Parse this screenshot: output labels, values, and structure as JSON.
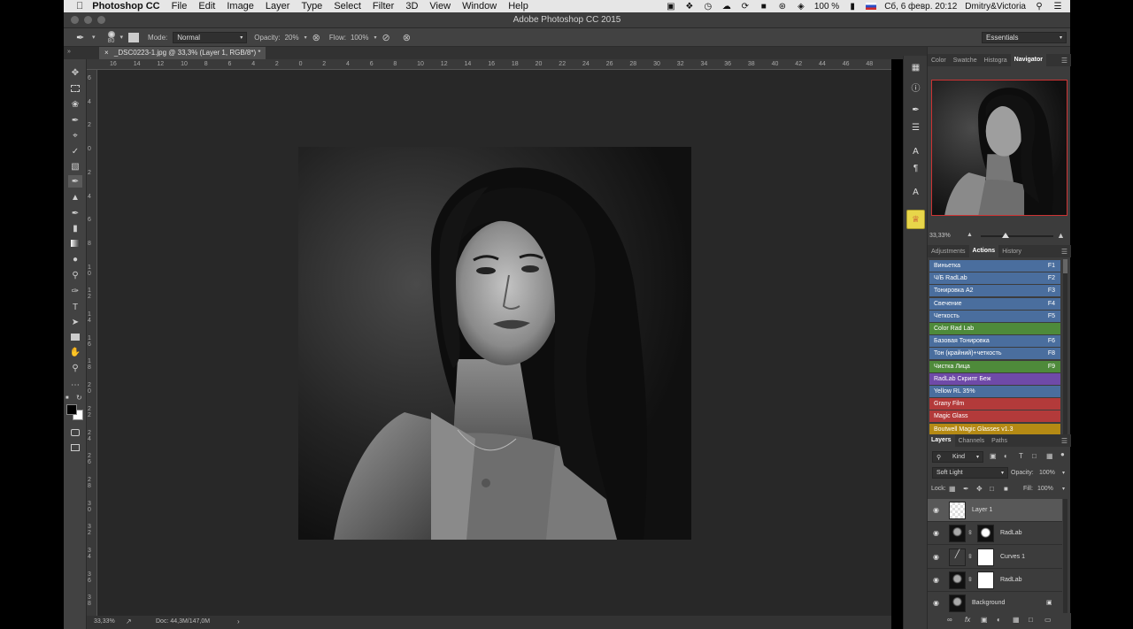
{
  "menubar": {
    "app": "Photoshop CC",
    "items": [
      "File",
      "Edit",
      "Image",
      "Layer",
      "Type",
      "Select",
      "Filter",
      "3D",
      "View",
      "Window",
      "Help"
    ],
    "battery": "100 %",
    "datetime": "Сб, 6 февр.  20:12",
    "user": "Dmitry&Victoria"
  },
  "titlebar": {
    "title": "Adobe Photoshop CC 2015"
  },
  "options": {
    "brush_size": "80",
    "mode_label": "Mode:",
    "mode_value": "Normal",
    "opacity_label": "Opacity:",
    "opacity_value": "20%",
    "flow_label": "Flow:",
    "flow_value": "100%",
    "workspace": "Essentials"
  },
  "document": {
    "tab_title": "_DSC0223-1.jpg @ 33,3% (Layer 1, RGB/8*) *",
    "zoom": "33,33%",
    "doc_size": "Doc: 44,3M/147,0M"
  },
  "ruler": {
    "h_labels": [
      "16",
      "14",
      "12",
      "10",
      "8",
      "6",
      "4",
      "2",
      "0",
      "2",
      "4",
      "6",
      "8",
      "10",
      "12",
      "14",
      "16",
      "18",
      "20",
      "22",
      "24",
      "26",
      "28",
      "30",
      "32",
      "34",
      "36",
      "38",
      "40",
      "42",
      "44",
      "46",
      "48"
    ],
    "v_labels": [
      "6",
      "4",
      "2",
      "0",
      "2",
      "4",
      "6",
      "8",
      "1 0",
      "1 2",
      "1 4",
      "1 6",
      "1 8",
      "2 0",
      "2 2",
      "2 4",
      "2 6",
      "2 8",
      "3 0",
      "3 2",
      "3 4",
      "3 6",
      "3 8"
    ]
  },
  "panels": {
    "top_tabs": [
      "Color",
      "Swatche",
      "Histogra",
      "Navigator"
    ],
    "top_active": "Navigator",
    "navigator_zoom": "33,33%",
    "mid_tabs": [
      "Adjustments",
      "Actions",
      "History"
    ],
    "mid_active": "Actions",
    "actions": [
      {
        "name": "Виньетка",
        "key": "F1",
        "color": "#4a6e9e"
      },
      {
        "name": "Ч/Б RadLab",
        "key": "F2",
        "color": "#4a6e9e"
      },
      {
        "name": "Тонировка А2",
        "key": "F3",
        "color": "#4a6e9e"
      },
      {
        "name": "Свечение",
        "key": "F4",
        "color": "#4a6e9e"
      },
      {
        "name": "Четкость",
        "key": "F5",
        "color": "#4a6e9e"
      },
      {
        "name": "Color Rad Lab",
        "key": "",
        "color": "#4e8a3a"
      },
      {
        "name": "Базовая Тонировка",
        "key": "F6",
        "color": "#4a6e9e"
      },
      {
        "name": "Тон (крайний)+четкость",
        "key": "F8",
        "color": "#4a6e9e"
      },
      {
        "name": "Чистка Лица",
        "key": "F9",
        "color": "#4e8a3a"
      },
      {
        "name": "RadLab Скрипт Беж",
        "key": "",
        "color": "#6f4aa8"
      },
      {
        "name": "Yellow RL 35%",
        "key": "",
        "color": "#4a6e9e"
      },
      {
        "name": "Grany Film",
        "key": "",
        "color": "#b33a3a"
      },
      {
        "name": "Magic Glass",
        "key": "",
        "color": "#b33a3a"
      },
      {
        "name": "Boutwell Magic Glasses v1.3",
        "key": "",
        "color": "#b58a14"
      }
    ],
    "layer_tabs": [
      "Layers",
      "Channels",
      "Paths"
    ],
    "layer_active": "Layers",
    "filter_kind": "Kind",
    "blend_mode": "Soft Light",
    "opacity_label": "Opacity:",
    "opacity_value": "100%",
    "lock_label": "Lock:",
    "fill_label": "Fill:",
    "fill_value": "100%",
    "layers": [
      {
        "name": "Layer 1",
        "selected": true,
        "mask": false
      },
      {
        "name": "RadLab",
        "selected": false,
        "mask": true
      },
      {
        "name": "Curves 1",
        "selected": false,
        "mask": true
      },
      {
        "name": "RadLab",
        "selected": false,
        "mask": true
      },
      {
        "name": "Background",
        "selected": false,
        "mask": false
      }
    ]
  }
}
